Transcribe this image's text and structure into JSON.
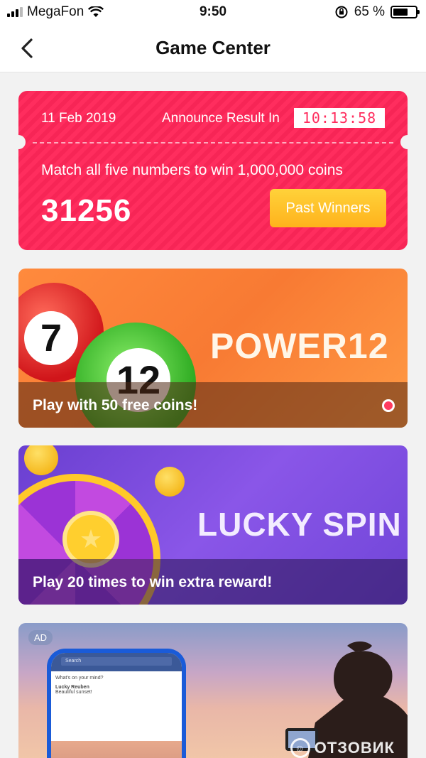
{
  "status_bar": {
    "carrier": "MegaFon",
    "time": "9:50",
    "battery_percent": "65 %",
    "battery_level": 0.65
  },
  "nav": {
    "title": "Game Center",
    "back_icon": "chevron-left-icon"
  },
  "lottery": {
    "date": "11 Feb 2019",
    "announce_label": "Announce Result In",
    "timer": "10:13:58",
    "prize_text": "Match all five numbers to win 1,000,000 coins",
    "number": "31256",
    "past_winners_label": "Past Winners"
  },
  "games": [
    {
      "name": "POWER12",
      "caption": "Play with 50 free coins!",
      "ball_numbers": [
        "7",
        "12"
      ]
    },
    {
      "name": "LUCKY SPIN",
      "caption": "Play 20 times to win extra reward!"
    }
  ],
  "ad": {
    "badge": "AD",
    "phone_app": "Search",
    "phone_post_prompt": "What's on your mind?",
    "phone_post_author": "Lucky Reuben",
    "phone_post_text": "Beautiful sunset!",
    "watermark": "ОТЗОВИК"
  },
  "colors": {
    "ticket": "#ff2d5e",
    "past_winners_button": "#ffc12a",
    "power12_banner": "#f87a33",
    "lucky_spin_banner": "#7a4ae0"
  }
}
